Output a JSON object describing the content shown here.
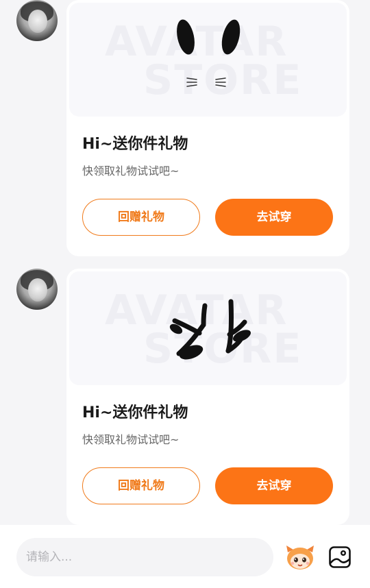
{
  "messages": [
    {
      "watermark_line1": "AVATAR",
      "watermark_line2": "STORE",
      "gift_item": "rabbit-ears-icon",
      "title": "Hi~送你件礼物",
      "subtitle": "快领取礼物试试吧~",
      "return_gift_label": "回赠礼物",
      "try_on_label": "去试穿"
    },
    {
      "watermark_line1": "AVATAR",
      "watermark_line2": "STORE",
      "gift_item": "antlers-icon",
      "title": "Hi~送你件礼物",
      "subtitle": "快领取礼物试试吧~",
      "return_gift_label": "回赠礼物",
      "try_on_label": "去试穿"
    }
  ],
  "input": {
    "placeholder": "请输入..."
  },
  "icons": {
    "mascot": "mascot-emoji-icon",
    "image": "image-icon"
  },
  "colors": {
    "accent": "#fc7416",
    "outline": "#f07a1a",
    "background": "#f5f5f7"
  }
}
